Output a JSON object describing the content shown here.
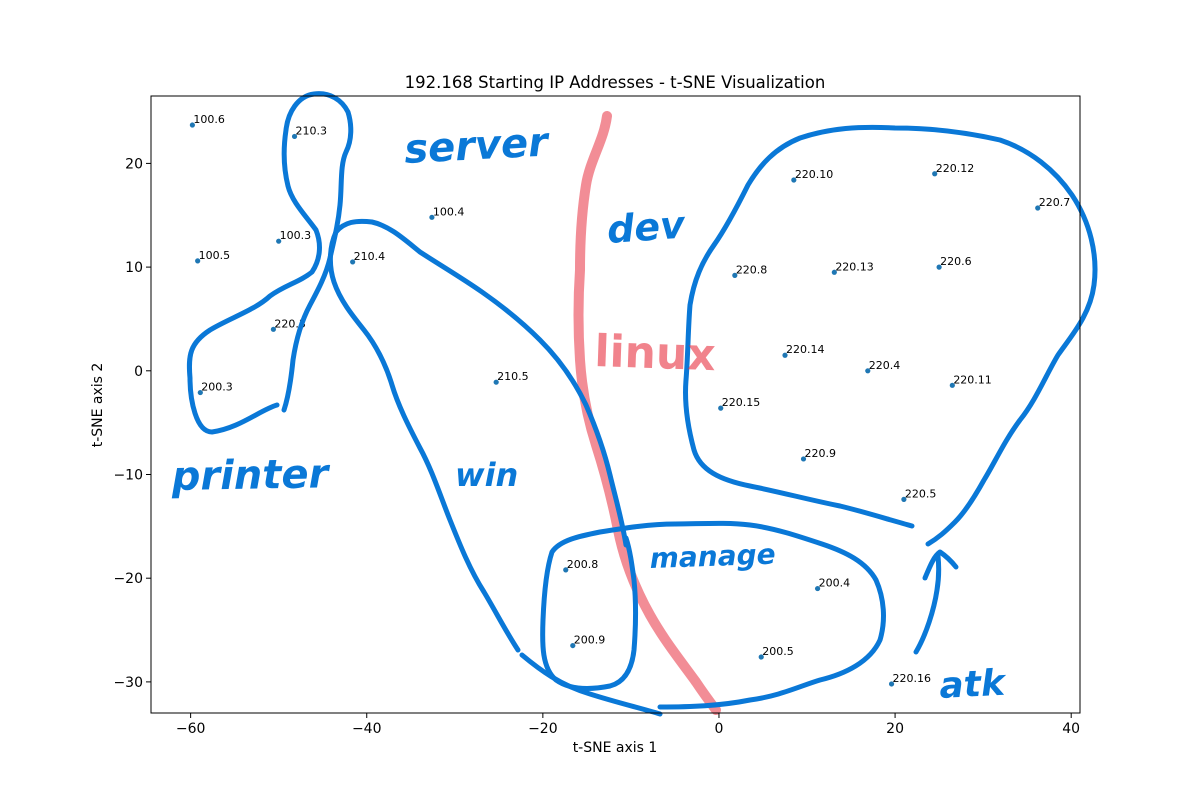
{
  "chart_data": {
    "type": "scatter",
    "title": "192.168 Starting IP Addresses - t-SNE Visualization",
    "xlabel": "t-SNE axis 1",
    "ylabel": "t-SNE axis 2",
    "xlim": [
      -64.5,
      41
    ],
    "ylim": [
      -33,
      26.5
    ],
    "xticks": [
      -60,
      -40,
      -20,
      0,
      20,
      40
    ],
    "yticks": [
      -30,
      -20,
      -10,
      0,
      10,
      20
    ],
    "xtick_labels": [
      "−60",
      "−40",
      "−20",
      "0",
      "20",
      "40"
    ],
    "ytick_labels": [
      "−30",
      "−20",
      "−10",
      "0",
      "10",
      "20"
    ],
    "grid": false,
    "marker_color": "#1f77b4",
    "points": [
      {
        "label": "100.6",
        "x": -59.8,
        "y": 23.7
      },
      {
        "label": "210.3",
        "x": -48.2,
        "y": 22.6
      },
      {
        "label": "100.3",
        "x": -50.0,
        "y": 12.5
      },
      {
        "label": "100.5",
        "x": -59.2,
        "y": 10.6
      },
      {
        "label": "100.4",
        "x": -32.6,
        "y": 14.8
      },
      {
        "label": "210.4",
        "x": -41.6,
        "y": 10.5
      },
      {
        "label": "220.3",
        "x": -50.6,
        "y": 4.0
      },
      {
        "label": "200.3",
        "x": -58.9,
        "y": -2.1
      },
      {
        "label": "210.5",
        "x": -25.3,
        "y": -1.1
      },
      {
        "label": "220.10",
        "x": 8.5,
        "y": 18.4
      },
      {
        "label": "220.12",
        "x": 24.5,
        "y": 19.0
      },
      {
        "label": "220.7",
        "x": 36.2,
        "y": 15.7
      },
      {
        "label": "220.8",
        "x": 1.8,
        "y": 9.2
      },
      {
        "label": "220.13",
        "x": 13.1,
        "y": 9.5
      },
      {
        "label": "220.6",
        "x": 25.0,
        "y": 10.0
      },
      {
        "label": "220.14",
        "x": 7.5,
        "y": 1.5
      },
      {
        "label": "220.4",
        "x": 16.9,
        "y": 0.0
      },
      {
        "label": "220.11",
        "x": 26.5,
        "y": -1.4
      },
      {
        "label": "220.15",
        "x": 0.2,
        "y": -3.6
      },
      {
        "label": "220.9",
        "x": 9.6,
        "y": -8.5
      },
      {
        "label": "220.5",
        "x": 21.0,
        "y": -12.4
      },
      {
        "label": "200.8",
        "x": -17.4,
        "y": -19.2
      },
      {
        "label": "200.4",
        "x": 11.2,
        "y": -21.0
      },
      {
        "label": "200.9",
        "x": -16.6,
        "y": -26.5
      },
      {
        "label": "200.5",
        "x": 4.8,
        "y": -27.6
      },
      {
        "label": "220.16",
        "x": 19.6,
        "y": -30.2
      }
    ],
    "annotations": [
      {
        "text": "server",
        "color": "#0a78d7"
      },
      {
        "text": "dev",
        "color": "#0a78d7"
      },
      {
        "text": "linux",
        "color": "#e8303f"
      },
      {
        "text": "printer",
        "color": "#0a78d7"
      },
      {
        "text": "win",
        "color": "#0a78d7"
      },
      {
        "text": "manage",
        "color": "#0a78d7"
      },
      {
        "text": "atk",
        "color": "#0a78d7"
      }
    ]
  }
}
